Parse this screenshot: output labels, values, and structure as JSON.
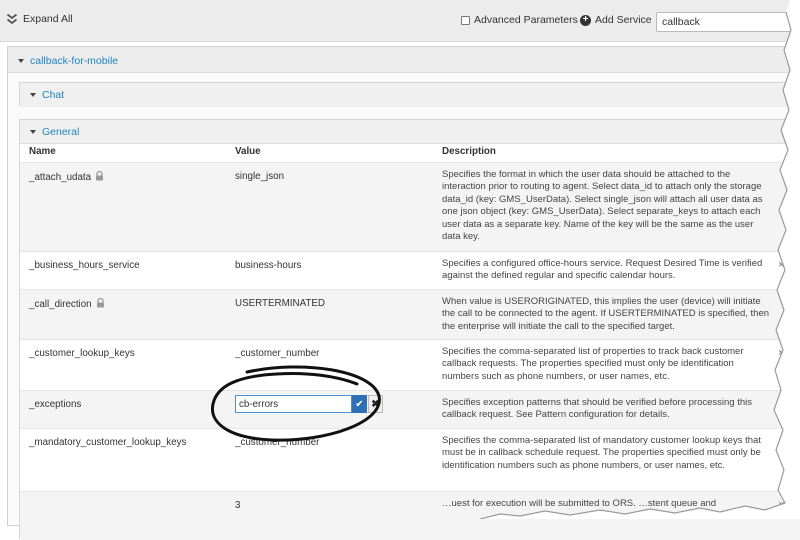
{
  "toolbar": {
    "expand_all_label": "Expand All",
    "advanced_params_label": "Advanced Parameters",
    "advanced_params_checked": false,
    "add_service_label": "Add Service",
    "search_value": "callback"
  },
  "service": {
    "name": "callback-for-mobile",
    "close_glyph": "×"
  },
  "sections": {
    "chat": "Chat",
    "general": "General"
  },
  "table": {
    "headers": {
      "name": "Name",
      "value": "Value",
      "description": "Description"
    },
    "rows": [
      {
        "name": "_attach_udata",
        "locked": true,
        "value": "single_json",
        "description": "Specifies the format in which the user data should be attached to the interaction prior to routing to agent. Select data_id to attach only the storage data_id (key: GMS_UserData). Select single_json will attach all user data as one json object (key: GMS_UserData). Select separate_keys to attach each user data as a separate key. Name of the key will be the same as the user data key."
      },
      {
        "name": "_business_hours_service",
        "locked": false,
        "value": "business-hours",
        "description": "Specifies a configured office-hours service. Request Desired Time is verified against the defined regular and specific calendar hours.",
        "delete_glyph": "×"
      },
      {
        "name": "_call_direction",
        "locked": true,
        "value": "USERTERMINATED",
        "description": "When value is USERORIGINATED, this implies the user (device) will initiate the call to be connected to the agent. If USERTERMINATED is specified, then the enterprise will initiate the call to the specified target."
      },
      {
        "name": "_customer_lookup_keys",
        "locked": false,
        "value": "_customer_number",
        "description": "Specifies the comma-separated list of properties to track back customer callback requests. The properties specified must only be identification numbers such as phone numbers, or user names, etc.",
        "delete_glyph": "×"
      },
      {
        "name": "_exceptions",
        "locked": false,
        "value": "cb-errors",
        "editing": true,
        "description": "Specifies exception patterns that should be verified before processing this callback request. See Pattern configuration for details.",
        "delete_glyph": "×"
      },
      {
        "name": "_mandatory_customer_lookup_keys",
        "locked": false,
        "value": "_customer_number",
        "description": "Specifies the comma-separated list of mandatory customer lookup keys that must be in callback schedule request. The properties specified must only be identification numbers such as phone numbers, or user names, etc.",
        "delete_glyph": "×"
      },
      {
        "name": "",
        "locked": false,
        "value": "3",
        "description": "…uest for execution will be submitted to ORS. …stent queue and",
        "delete_glyph": "×"
      }
    ]
  },
  "edit_controls": {
    "ok_glyph": "✔",
    "cancel_glyph": "✖"
  }
}
